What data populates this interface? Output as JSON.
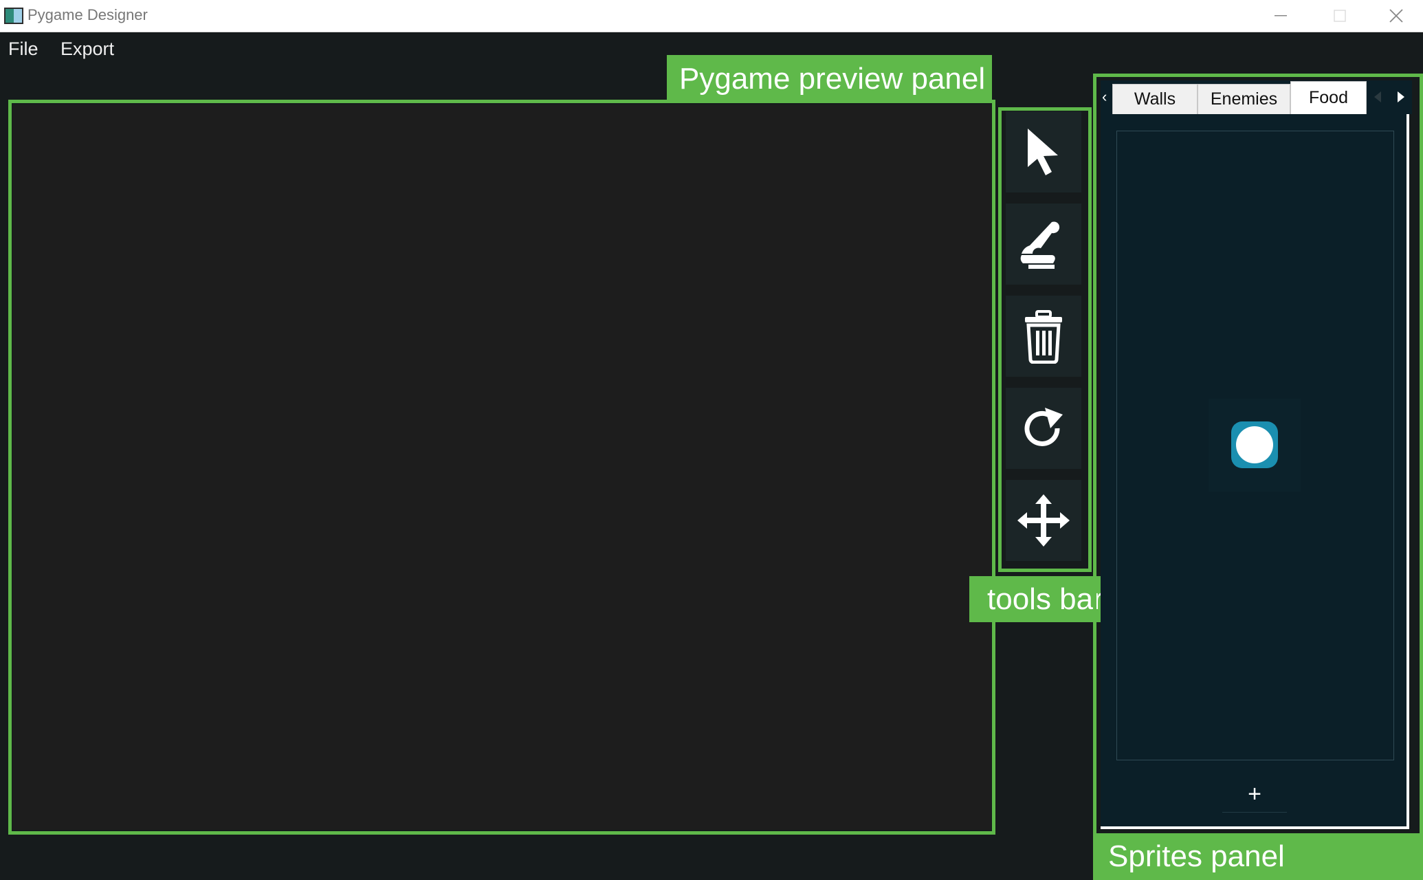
{
  "window": {
    "title": "Pygame Designer",
    "controls": [
      "minimize-icon",
      "maximize-icon",
      "close-icon"
    ]
  },
  "menu": {
    "items": [
      {
        "label": "File"
      },
      {
        "label": "Export"
      }
    ]
  },
  "preview_panel": {
    "callout_label": "Pygame preview panel"
  },
  "tools_bar": {
    "callout_label": "tools bar",
    "tools": [
      {
        "name": "select",
        "icon": "cursor-arrow-icon"
      },
      {
        "name": "stamp",
        "icon": "stamp-icon"
      },
      {
        "name": "delete",
        "icon": "trash-icon"
      },
      {
        "name": "rotate",
        "icon": "rotate-icon"
      },
      {
        "name": "move",
        "icon": "move-arrows-icon"
      }
    ]
  },
  "sprites_panel": {
    "callout_label": "Sprites panel",
    "tabs": [
      {
        "label": "Walls",
        "active": false
      },
      {
        "label": "Enemies",
        "active": false
      },
      {
        "label": "Food",
        "active": true
      }
    ],
    "sprites": [
      {
        "icon": "food-sprite-icon"
      }
    ],
    "add_button_label": "+"
  },
  "colors": {
    "callout_green": "#5fb94a",
    "app_background": "#161b1c",
    "preview_background": "#1d1d1d",
    "sprites_background": "#0b1f28",
    "food_sprite": "#1b8fb0"
  }
}
